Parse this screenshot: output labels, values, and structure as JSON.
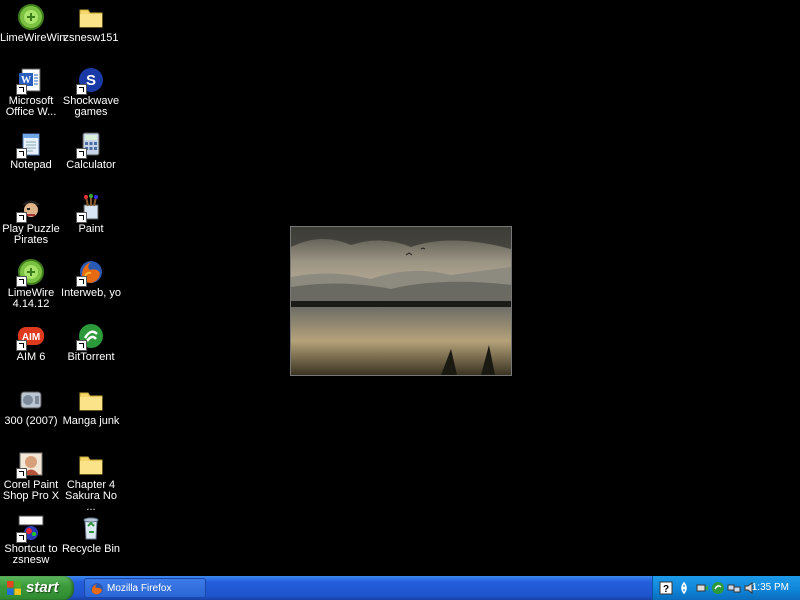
{
  "desktop": {
    "icons": [
      {
        "label": "LimeWireWin",
        "icon": "limewire-icon"
      },
      {
        "label": "zsnesw151",
        "icon": "folder-icon"
      },
      {
        "label": "Microsoft Office W...",
        "icon": "word-icon"
      },
      {
        "label": "Shockwave games",
        "icon": "shockwave-icon"
      },
      {
        "label": "Notepad",
        "icon": "notepad-icon"
      },
      {
        "label": "Calculator",
        "icon": "calculator-icon"
      },
      {
        "label": "Play Puzzle Pirates",
        "icon": "puzzle-pirates-icon"
      },
      {
        "label": "Paint",
        "icon": "paint-icon"
      },
      {
        "label": "LimeWire 4.14.12",
        "icon": "limewire-icon"
      },
      {
        "label": "Interweb, yo",
        "icon": "firefox-icon"
      },
      {
        "label": "AIM 6",
        "icon": "aim-icon"
      },
      {
        "label": "BitTorrent",
        "icon": "bittorrent-icon"
      },
      {
        "label": "300 (2007)",
        "icon": "video-file-icon"
      },
      {
        "label": "Manga junk",
        "icon": "folder-icon"
      },
      {
        "label": "Corel Paint Shop Pro X",
        "icon": "corel-paint-shop-icon"
      },
      {
        "label": "Chapter 4 Sakura No ...",
        "icon": "folder-icon"
      },
      {
        "label": "Shortcut to zsnesw",
        "icon": "zsnes-icon"
      },
      {
        "label": "Recycle Bin",
        "icon": "recycle-bin-icon"
      }
    ]
  },
  "wallpaper": {
    "icon": "landscape-wallpaper-image"
  },
  "taskbar": {
    "start_label": "start",
    "task_items": [
      {
        "label": "Mozilla Firefox",
        "icon": "firefox-icon"
      }
    ],
    "tray_icons": [
      "help-icon",
      "network-icon",
      "safely-remove-icon",
      "bittorrent-tray-icon",
      "connection-icon",
      "volume-icon"
    ],
    "clock": "1:35 PM"
  },
  "colors": {
    "desktop_bg": "#000000",
    "taskbar_blue": "#245edb",
    "start_green": "#3c9a3c",
    "tray_blue": "#0f83d6"
  }
}
